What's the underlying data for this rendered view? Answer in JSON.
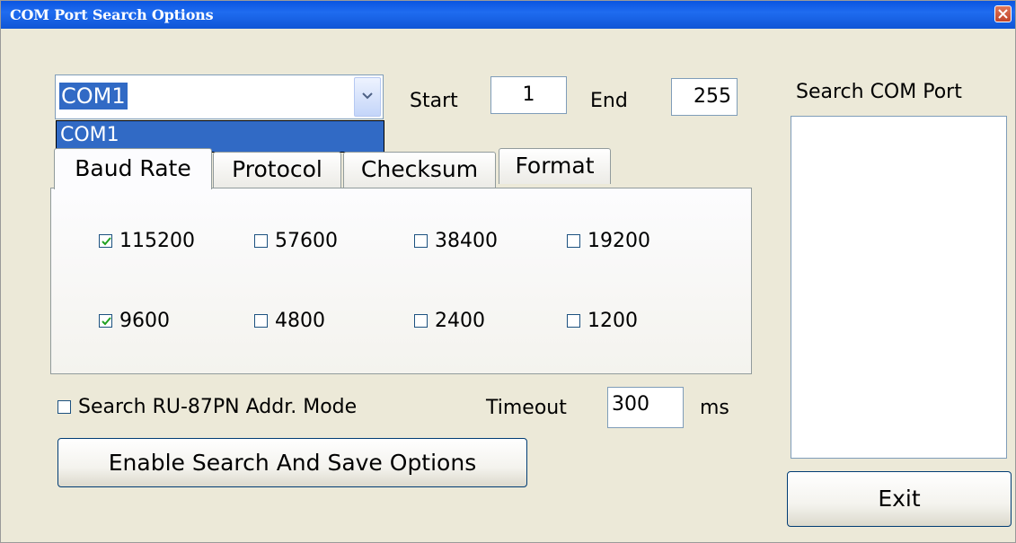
{
  "window": {
    "title": "COM Port Search Options"
  },
  "combo": {
    "value": "COM1",
    "options": [
      "COM1"
    ]
  },
  "range": {
    "start_label": "Start",
    "start_value": "1",
    "end_label": "End",
    "end_value": "255"
  },
  "tabs": [
    {
      "label": "Baud Rate",
      "active": true
    },
    {
      "label": "Protocol",
      "active": false
    },
    {
      "label": "Checksum",
      "active": false
    },
    {
      "label": "Format",
      "active": false
    }
  ],
  "baud_rates": [
    {
      "label": "115200",
      "checked": true
    },
    {
      "label": "57600",
      "checked": false
    },
    {
      "label": "38400",
      "checked": false
    },
    {
      "label": "19200",
      "checked": false
    },
    {
      "label": "9600",
      "checked": true
    },
    {
      "label": "4800",
      "checked": false
    },
    {
      "label": "2400",
      "checked": false
    },
    {
      "label": "1200",
      "checked": false
    }
  ],
  "addr_mode": {
    "label": "Search RU-87PN Addr. Mode",
    "checked": false
  },
  "timeout": {
    "label": "Timeout",
    "value": "300",
    "unit": "ms"
  },
  "buttons": {
    "enable": "Enable Search And Save  Options",
    "exit": "Exit"
  },
  "search_list": {
    "label": "Search COM Port",
    "items": []
  },
  "colors": {
    "titlebar": "#0a54e0",
    "selection": "#316ac5",
    "face": "#ece9d8",
    "checkmark": "#21a121"
  }
}
